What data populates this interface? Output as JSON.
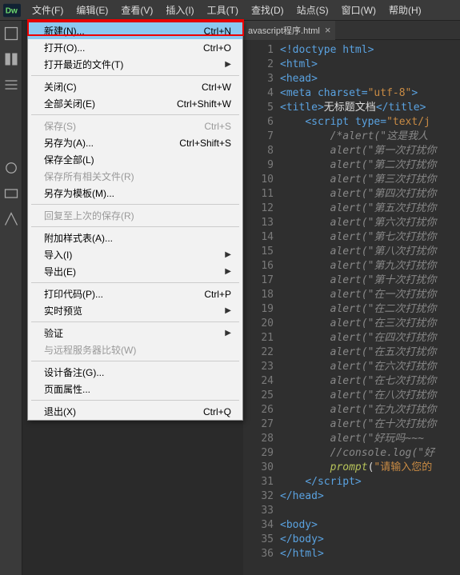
{
  "menubar": {
    "items": [
      "文件(F)",
      "编辑(E)",
      "查看(V)",
      "插入(I)",
      "工具(T)",
      "查找(D)",
      "站点(S)",
      "窗口(W)",
      "帮助(H)"
    ]
  },
  "dropdown": {
    "rows": [
      {
        "label": "新建(N)...",
        "shortcut": "Ctrl+N",
        "highlight": true
      },
      {
        "label": "打开(O)...",
        "shortcut": "Ctrl+O"
      },
      {
        "label": "打开最近的文件(T)",
        "submenu": true
      },
      {
        "sep": true
      },
      {
        "label": "关闭(C)",
        "shortcut": "Ctrl+W"
      },
      {
        "label": "全部关闭(E)",
        "shortcut": "Ctrl+Shift+W"
      },
      {
        "sep": true
      },
      {
        "label": "保存(S)",
        "shortcut": "Ctrl+S",
        "disabled": true
      },
      {
        "label": "另存为(A)...",
        "shortcut": "Ctrl+Shift+S"
      },
      {
        "label": "保存全部(L)"
      },
      {
        "label": "保存所有相关文件(R)",
        "disabled": true
      },
      {
        "label": "另存为模板(M)..."
      },
      {
        "sep": true
      },
      {
        "label": "回复至上次的保存(R)",
        "disabled": true
      },
      {
        "sep": true
      },
      {
        "label": "附加样式表(A)..."
      },
      {
        "label": "导入(I)",
        "submenu": true
      },
      {
        "label": "导出(E)",
        "submenu": true
      },
      {
        "sep": true
      },
      {
        "label": "打印代码(P)...",
        "shortcut": "Ctrl+P"
      },
      {
        "label": "实时预览",
        "submenu": true
      },
      {
        "sep": true
      },
      {
        "label": "验证",
        "submenu": true
      },
      {
        "label": "与远程服务器比较(W)",
        "disabled": true
      },
      {
        "sep": true
      },
      {
        "label": "设计备注(G)..."
      },
      {
        "label": "页面属性..."
      },
      {
        "sep": true
      },
      {
        "label": "退出(X)",
        "shortcut": "Ctrl+Q"
      }
    ]
  },
  "tab": {
    "label": "avascript程序.html"
  },
  "code": {
    "lines": [
      {
        "n": 1,
        "html": "<span class='t-tag'>&lt;!doctype html&gt;</span>"
      },
      {
        "n": 2,
        "fold": true,
        "html": "<span class='t-tag'>&lt;html&gt;</span>"
      },
      {
        "n": 3,
        "fold": true,
        "html": "<span class='t-tag'>&lt;head&gt;</span>"
      },
      {
        "n": 4,
        "html": "<span class='t-tag'>&lt;meta</span> <span class='t-attr'>charset=</span><span class='t-str'>\"utf-8\"</span><span class='t-tag'>&gt;</span>"
      },
      {
        "n": 5,
        "html": "<span class='t-tag'>&lt;title&gt;</span><span class='t-text'>无标题文档</span><span class='t-tag'>&lt;/title&gt;</span>"
      },
      {
        "n": 6,
        "fold": true,
        "html": "    <span class='t-tag'>&lt;script</span> <span class='t-attr'>type=</span><span class='t-str'>\"text/j</span>"
      },
      {
        "n": 7,
        "fold": true,
        "html": "        <span class='t-comment'>/*alert(\"这是我人</span>"
      },
      {
        "n": 8,
        "html": "        <span class='t-comment'>alert(\"第一次打扰你</span>"
      },
      {
        "n": 9,
        "html": "        <span class='t-comment'>alert(\"第二次打扰你</span>"
      },
      {
        "n": 10,
        "html": "        <span class='t-comment'>alert(\"第三次打扰你</span>"
      },
      {
        "n": 11,
        "html": "        <span class='t-comment'>alert(\"第四次打扰你</span>"
      },
      {
        "n": 12,
        "html": "        <span class='t-comment'>alert(\"第五次打扰你</span>"
      },
      {
        "n": 13,
        "html": "        <span class='t-comment'>alert(\"第六次打扰你</span>"
      },
      {
        "n": 14,
        "html": "        <span class='t-comment'>alert(\"第七次打扰你</span>"
      },
      {
        "n": 15,
        "html": "        <span class='t-comment'>alert(\"第八次打扰你</span>"
      },
      {
        "n": 16,
        "html": "        <span class='t-comment'>alert(\"第九次打扰你</span>"
      },
      {
        "n": 17,
        "html": "        <span class='t-comment'>alert(\"第十次打扰你</span>"
      },
      {
        "n": 18,
        "html": "        <span class='t-comment'>alert(\"在一次打扰你</span>"
      },
      {
        "n": 19,
        "html": "        <span class='t-comment'>alert(\"在二次打扰你</span>"
      },
      {
        "n": 20,
        "html": "        <span class='t-comment'>alert(\"在三次打扰你</span>"
      },
      {
        "n": 21,
        "html": "        <span class='t-comment'>alert(\"在四次打扰你</span>"
      },
      {
        "n": 22,
        "html": "        <span class='t-comment'>alert(\"在五次打扰你</span>"
      },
      {
        "n": 23,
        "html": "        <span class='t-comment'>alert(\"在六次打扰你</span>"
      },
      {
        "n": 24,
        "html": "        <span class='t-comment'>alert(\"在七次打扰你</span>"
      },
      {
        "n": 25,
        "html": "        <span class='t-comment'>alert(\"在八次打扰你</span>"
      },
      {
        "n": 26,
        "html": "        <span class='t-comment'>alert(\"在九次打扰你</span>"
      },
      {
        "n": 27,
        "html": "        <span class='t-comment'>alert(\"在十次打扰你</span>"
      },
      {
        "n": 28,
        "html": "        <span class='t-comment'>alert(\"好玩吗~~~</span>"
      },
      {
        "n": 29,
        "html": "        <span class='t-comment'>//console.log(\"好</span>"
      },
      {
        "n": 30,
        "html": "        <span class='t-func'>prompt</span><span class='t-paren'>(</span><span class='t-str'>\"请输入您的</span>"
      },
      {
        "n": 31,
        "html": "    <span class='t-tag'>&lt;/script&gt;</span>"
      },
      {
        "n": 32,
        "html": "<span class='t-tag'>&lt;/head&gt;</span>"
      },
      {
        "n": 33,
        "html": ""
      },
      {
        "n": 34,
        "html": "<span class='t-tag'>&lt;body&gt;</span>"
      },
      {
        "n": 35,
        "html": "<span class='t-tag'>&lt;/body&gt;</span>"
      },
      {
        "n": 36,
        "html": "<span class='t-tag'>&lt;/html&gt;</span>"
      }
    ]
  }
}
